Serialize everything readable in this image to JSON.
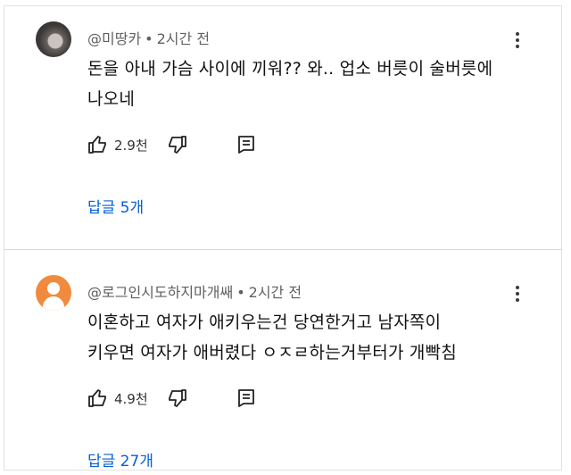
{
  "comments": [
    {
      "author": "@미땅카",
      "time": "2시간 전",
      "text_lines": [
        "돈을 아내 가슴 사이에 끼워?? 와.. 업소 버릇이 술버릇에",
        "나오네"
      ],
      "likes": "2.9천",
      "replies_label": "답글 5개",
      "avatar": "photo-avatar"
    },
    {
      "author": "@로그인시도하지마개쌔",
      "time": "2시간 전",
      "text_lines": [
        "이혼하고 여자가 애키우는건 당연한거고 남자쪽이",
        "키우면 여자가 애버렸다 ㅇㅈㄹ하는거부터가 개빡침"
      ],
      "likes": "4.9천",
      "replies_label": "답글 27개",
      "avatar": "default-avatar"
    }
  ],
  "separator": "•",
  "icons": {
    "like": "thumbs-up-icon",
    "dislike": "thumbs-down-icon",
    "reply": "comment-reply-icon",
    "more": "more-vertical-icon"
  },
  "colors": {
    "link": "#065fd4",
    "meta": "#606060",
    "avatar_orange": "#f08a3e"
  }
}
